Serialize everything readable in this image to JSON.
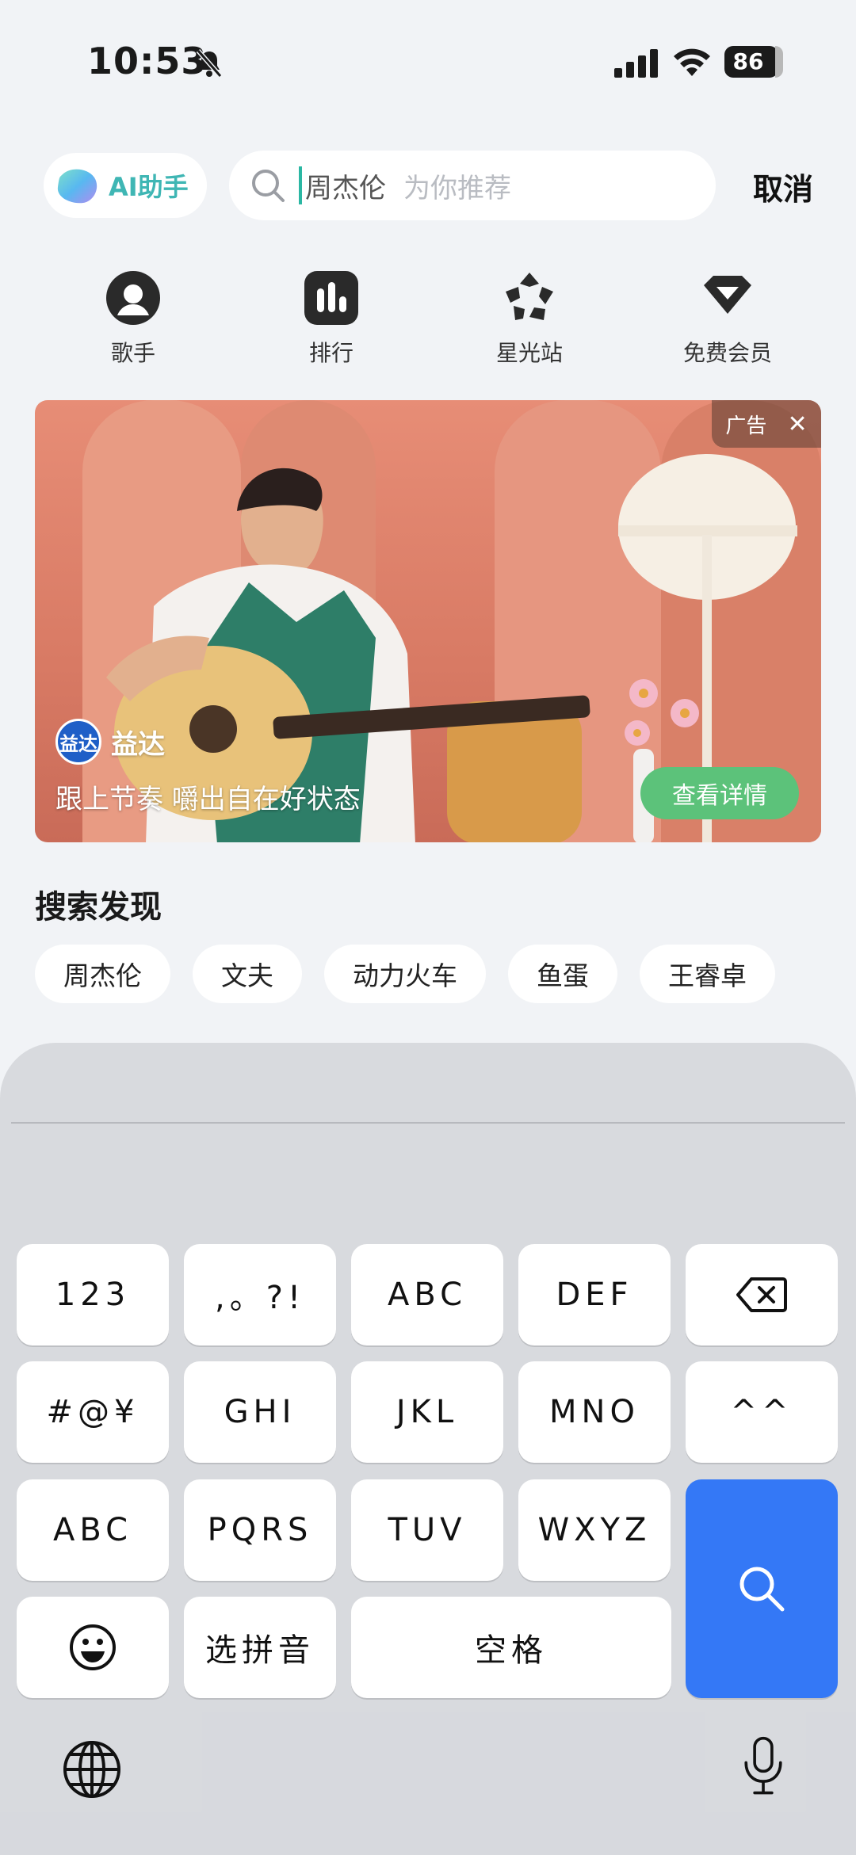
{
  "status_bar": {
    "time": "10:53",
    "battery": "86"
  },
  "search": {
    "ai_button_label": "AI助手",
    "query": "周杰伦",
    "placeholder": "为你推荐",
    "cancel_label": "取消"
  },
  "quick_entries": [
    {
      "label": "歌手",
      "icon": "singer-icon"
    },
    {
      "label": "排行",
      "icon": "chart-icon"
    },
    {
      "label": "星光站",
      "icon": "starlight-icon"
    },
    {
      "label": "免费会员",
      "icon": "vip-diamond-icon"
    }
  ],
  "ad": {
    "badge": "广告",
    "brand_logo_text": "益达",
    "brand_name": "益达",
    "slogan": "跟上节奏 嚼出自在好状态",
    "detail_button": "查看详情"
  },
  "discovery": {
    "title": "搜索发现",
    "chips": [
      "周杰伦",
      "文夫",
      "动力火车",
      "鱼蛋",
      "王睿卓"
    ]
  },
  "keyboard": {
    "row1": [
      "123",
      ",。?!",
      "ABC",
      "DEF"
    ],
    "row2": [
      "#@¥",
      "GHI",
      "JKL",
      "MNO",
      "^^"
    ],
    "row3": [
      "ABC",
      "PQRS",
      "TUV",
      "WXYZ"
    ],
    "row4": [
      "选拼音",
      "空格"
    ],
    "accent_color": "#3478f6"
  }
}
